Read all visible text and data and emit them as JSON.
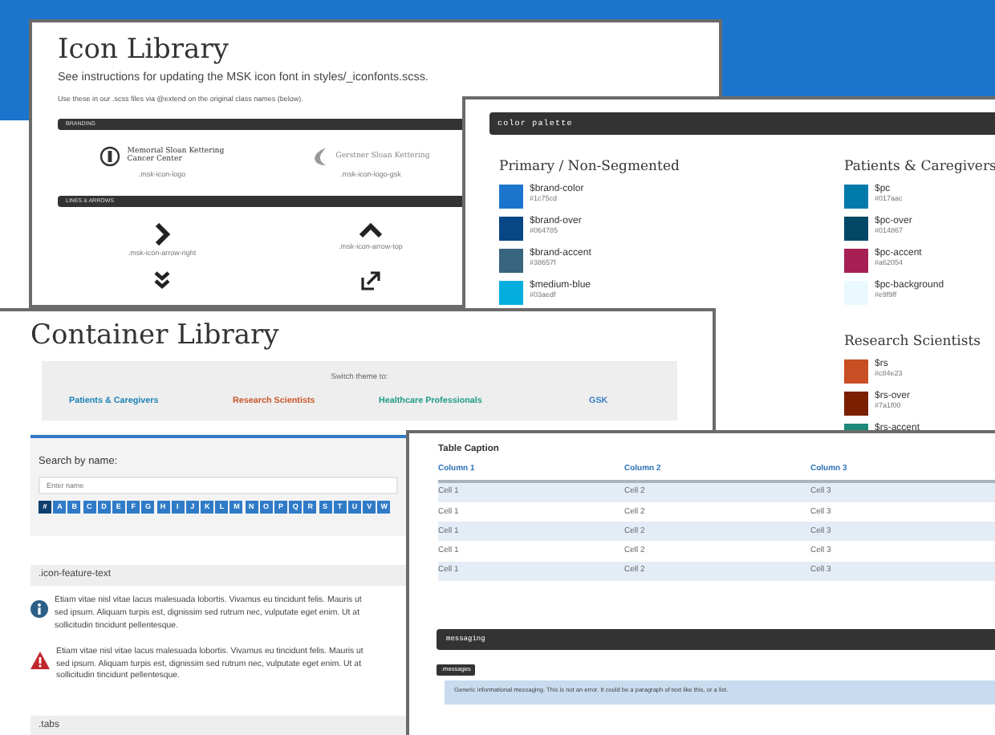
{
  "icon_library": {
    "title": "Icon Library",
    "subtitle": "See instructions for updating the MSK icon font in styles/_iconfonts.scss.",
    "note": "Use these in our .scss files via @extend on the original class names (below).",
    "sections": [
      {
        "heading": "BRANDING",
        "items": [
          {
            "kind": "logo-msk",
            "lines": [
              "Memorial Sloan Kettering",
              "Cancer Center"
            ],
            "caption": ".msk-icon-logo"
          },
          {
            "kind": "logo-gsk",
            "lines": [
              "Gerstner Sloan Kettering"
            ],
            "caption": ".msk-icon-logo-gsk"
          }
        ]
      },
      {
        "heading": "LINES & ARROWS",
        "items": [
          {
            "kind": "arrow-right",
            "caption": ".msk-icon-arrow-right"
          },
          {
            "kind": "arrow-top",
            "caption": ".msk-icon-arrow-top"
          },
          {
            "kind": "double-down"
          },
          {
            "kind": "expand"
          }
        ]
      }
    ]
  },
  "color_palette": {
    "heading": "color palette",
    "groups": [
      {
        "title": "Primary / Non-Segmented",
        "colors": [
          {
            "name": "$brand-color",
            "hex": "#1c75cd",
            "color": "#1c75cd"
          },
          {
            "name": "$brand-over",
            "hex": "#064785",
            "color": "#064785"
          },
          {
            "name": "$brand-accent",
            "hex": "#38657f",
            "color": "#38657f"
          },
          {
            "name": "$medium-blue",
            "hex": "#03aedf",
            "color": "#03aedf"
          }
        ]
      },
      {
        "title": "Patients & Caregivers",
        "colors": [
          {
            "name": "$pc",
            "hex": "#017aac",
            "color": "#017aac"
          },
          {
            "name": "$pc-over",
            "hex": "#014867",
            "color": "#014867"
          },
          {
            "name": "$pc-accent",
            "hex": "#a62054",
            "color": "#a62054"
          },
          {
            "name": "$pc-background",
            "hex": "#e9f9ff",
            "color": "#e9f9ff"
          }
        ]
      },
      {
        "title": "Research Scientists",
        "colors": [
          {
            "name": "$rs",
            "hex": "#c84e23",
            "color": "#c84e23"
          },
          {
            "name": "$rs-over",
            "hex": "#7a1f00",
            "color": "#7a1f00"
          },
          {
            "name": "$rs-accent",
            "color": "#1b8a7a"
          }
        ]
      }
    ]
  },
  "container_library": {
    "title": "Container Library",
    "theme_label": "Switch theme to:",
    "themes": [
      {
        "label": "Patients & Caregivers",
        "color": "#1a82b4"
      },
      {
        "label": "Research Scientists",
        "color": "#c8552b"
      },
      {
        "label": "Healthcare Professionals",
        "color": "#1d9a86"
      },
      {
        "label": "GSK",
        "color": "#3b7fc4"
      }
    ],
    "search": {
      "label": "Search by name:",
      "placeholder": "Enter name"
    },
    "letters": [
      {
        "label": "#",
        "selected": true
      },
      {
        "label": "A",
        "selected": false
      },
      {
        "label": "B",
        "selected": false
      },
      {
        "label": "C",
        "selected": false
      },
      {
        "label": "D",
        "selected": false
      },
      {
        "label": "E",
        "selected": false
      },
      {
        "label": "F",
        "selected": false
      },
      {
        "label": "G",
        "selected": false
      },
      {
        "label": "H",
        "selected": false
      },
      {
        "label": "I",
        "selected": false
      },
      {
        "label": "J",
        "selected": false
      },
      {
        "label": "K",
        "selected": false
      },
      {
        "label": "L",
        "selected": false
      },
      {
        "label": "M",
        "selected": false
      },
      {
        "label": "N",
        "selected": false
      },
      {
        "label": "O",
        "selected": false
      },
      {
        "label": "P",
        "selected": false
      },
      {
        "label": "Q",
        "selected": false
      },
      {
        "label": "R",
        "selected": false
      },
      {
        "label": "S",
        "selected": false
      },
      {
        "label": "T",
        "selected": false
      },
      {
        "label": "U",
        "selected": false
      },
      {
        "label": "V",
        "selected": false
      },
      {
        "label": "W",
        "selected": false
      }
    ],
    "feature_heading": ".icon-feature-text",
    "features": [
      {
        "kind": "info",
        "lines": [
          "Etiam vitae nisl vitae lacus malesuada lobortis. Vivamus eu tincidunt felis. Mauris ut",
          "sed ipsum. Aliquam turpis est, dignissim sed rutrum nec, vulputate eget enim. Ut at",
          "sollicitudin tincidunt pellentesque."
        ]
      },
      {
        "kind": "warning",
        "lines": [
          "Etiam vitae nisl vitae lacus malesuada lobortis. Vivamus eu tincidunt felis. Mauris ut",
          "sed ipsum. Aliquam turpis est, dignissim sed rutrum nec, vulputate eget enim. Ut at",
          "sollicitudin tincidunt pellentesque."
        ]
      }
    ],
    "tabs_heading": ".tabs"
  },
  "table_panel": {
    "caption": "Table Caption",
    "columns": [
      "Column 1",
      "Column 2",
      "Column 3"
    ],
    "rows": [
      [
        "Cell 1",
        "Cell 2",
        "Cell 3"
      ],
      [
        "Cell 1",
        "Cell 2",
        "Cell 3"
      ],
      [
        "Cell 1",
        "Cell 2",
        "Cell 3"
      ],
      [
        "Cell 1",
        "Cell 2",
        "Cell 3"
      ],
      [
        "Cell 1",
        "Cell 2",
        "Cell 3"
      ]
    ],
    "messaging_heading": "messaging",
    "messages_tag": ".messages",
    "info_message": "Generic informational messaging. This is not an error. It could be a paragraph of text like this, or a list."
  }
}
